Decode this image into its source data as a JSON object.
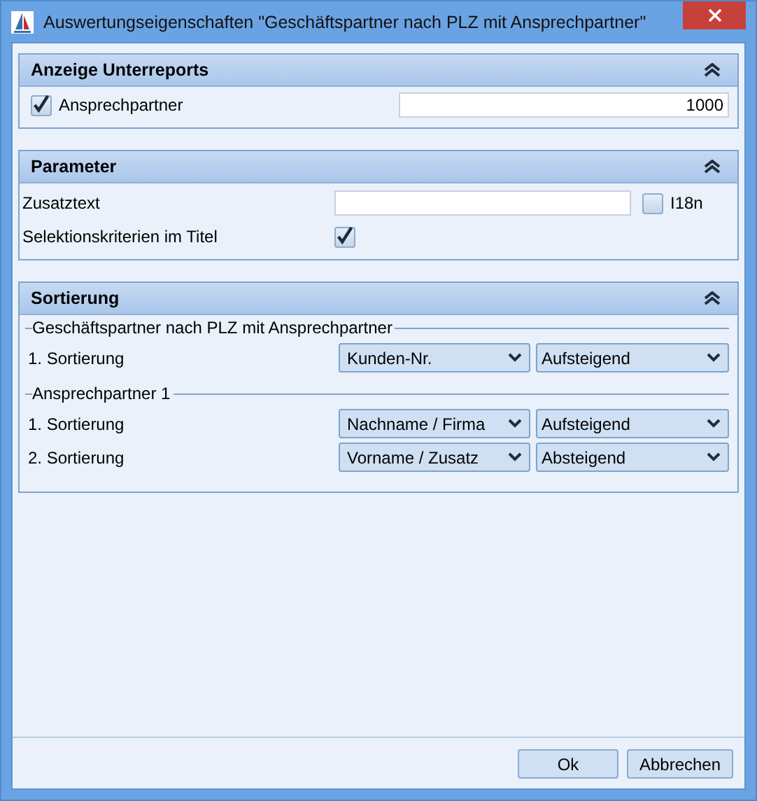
{
  "window": {
    "title": "Auswertungseigenschaften \"Geschäftspartner nach PLZ mit Ansprechpartner\""
  },
  "subreports": {
    "title": "Anzeige Unterreports",
    "expanded": true,
    "item": {
      "label": "Ansprechpartner",
      "checked": true,
      "value": "1000"
    }
  },
  "parameters": {
    "title": "Parameter",
    "expanded": true,
    "extra_text": {
      "label": "Zusatztext",
      "i18n_label": "I18n",
      "i18n_checked": false
    },
    "criteria_in_title": {
      "label": "Selektionskriterien im Titel",
      "checked": true
    }
  },
  "sorting": {
    "title": "Sortierung",
    "expanded": true,
    "groups": [
      {
        "title": "Geschäftspartner nach PLZ mit Ansprechpartner",
        "rows": [
          {
            "label": "1. Sortierung",
            "field": "Kunden-Nr.",
            "order": "Aufsteigend"
          }
        ]
      },
      {
        "title": "Ansprechpartner 1",
        "rows": [
          {
            "label": "1. Sortierung",
            "field": "Nachname / Firma",
            "order": "Aufsteigend"
          },
          {
            "label": "2. Sortierung",
            "field": "Vorname / Zusatz",
            "order": "Absteigend"
          }
        ]
      }
    ]
  },
  "buttons": [
    "Ok",
    "Abbrechen"
  ]
}
